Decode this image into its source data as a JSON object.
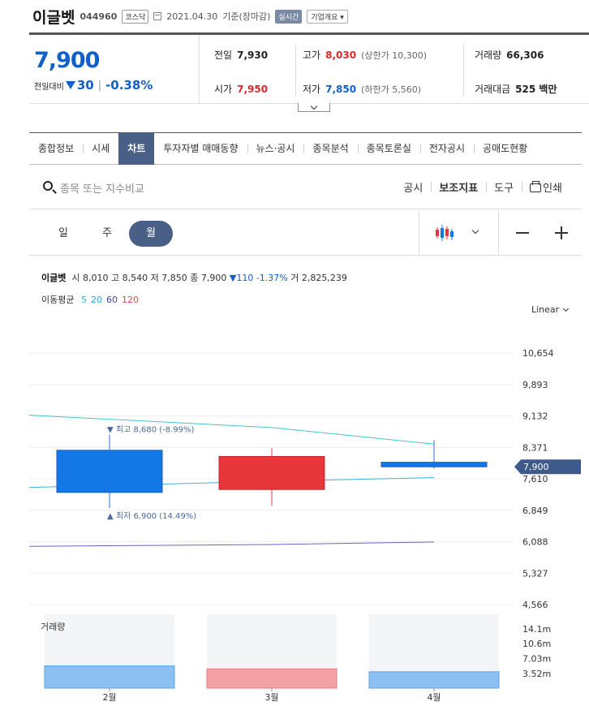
{
  "header": {
    "name": "이글벳",
    "code": "044960",
    "market": "코스닥",
    "date": "2021.04.30",
    "basis": "기준(장마감)",
    "live_badge": "실시간",
    "company_info": "기업개요"
  },
  "quote": {
    "price": "7,900",
    "change_label": "전일대비",
    "change": "30",
    "change_pct": "-0.38%",
    "prev_label": "전일",
    "prev": "7,930",
    "high_label": "고가",
    "high": "8,030",
    "upper_limit": "(상한가 10,300)",
    "volume_label": "거래량",
    "volume": "66,306",
    "open_label": "시가",
    "open": "7,950",
    "low_label": "저가",
    "low": "7,850",
    "lower_limit": "(하한가 5,560)",
    "amount_label": "거래대금",
    "amount": "525 백만"
  },
  "tabs": [
    "종합정보",
    "시세",
    "차트",
    "투자자별 매매동향",
    "뉴스·공시",
    "종목분석",
    "종목토론실",
    "전자공시",
    "공매도현황"
  ],
  "active_tab": 2,
  "search": {
    "placeholder": "종목 또는 지수비교",
    "disclosure": "공시",
    "indicators": "보조지표",
    "tools": "도구",
    "print": "인쇄"
  },
  "periods": [
    "일",
    "주",
    "월"
  ],
  "active_period": 2,
  "legend": {
    "name": "이글벳",
    "open_label": "시",
    "open": "8,010",
    "high_label": "고",
    "high": "8,540",
    "low_label": "저",
    "low": "7,850",
    "close_label": "종",
    "close": "7,900",
    "change": "▼110 -1.37%",
    "vol_label": "거",
    "volume": "2,825,239",
    "ma_label": "이동평균",
    "ma": [
      {
        "label": "5",
        "color": "#3ab0c0"
      },
      {
        "label": "20",
        "color": "#3a9ad8"
      },
      {
        "label": "60",
        "color": "#3c4aa0"
      },
      {
        "label": "120",
        "color": "#e05050"
      }
    ]
  },
  "scale_mode": "Linear",
  "volume_title": "거래량",
  "colors": {
    "up": "#e8373b",
    "down": "#1477e6",
    "accent": "#4a5f86",
    "price_tag": "#3d5a8a"
  },
  "chart_data": {
    "type": "candlestick",
    "categories": [
      "2월",
      "3월",
      "4월"
    ],
    "candles": [
      {
        "open": 8300,
        "high": 8680,
        "low": 6900,
        "close": 7280
      },
      {
        "open": 7350,
        "high": 8350,
        "low": 6960,
        "close": 8150
      },
      {
        "open": 8010,
        "high": 8540,
        "low": 7850,
        "close": 7900
      }
    ],
    "moving_averages": [
      {
        "name": "5",
        "values": [
          9050,
          8850,
          8450
        ]
      },
      {
        "name": "20",
        "values": [
          7450,
          7550,
          7640
        ]
      },
      {
        "name": "60",
        "values": [
          5990,
          6020,
          6080
        ]
      }
    ],
    "y_ticks": [
      10654,
      9893,
      9132,
      8371,
      7610,
      6849,
      6088,
      5327,
      4566
    ],
    "y_tick_labels": [
      "10,654",
      "9,893",
      "9,132",
      "8,371",
      "7,610",
      "6,849",
      "6,088",
      "5,327",
      "4,566"
    ],
    "ylim": [
      4566,
      10654
    ],
    "current_price": 7900,
    "current_price_label": "7,900",
    "max_annotation": "▼ 최고 8,680 (-8.99%)",
    "min_annotation": "▲ 최저 6,900 (14.49%)",
    "volume": {
      "values": [
        5.3,
        4.6,
        3.9
      ],
      "unit": "m",
      "ticks": [
        14.1,
        10.6,
        7.03,
        3.52
      ],
      "tick_labels": [
        "14.1m",
        "10.6m",
        "7.03m",
        "3.52m"
      ],
      "ymax": 17.6
    }
  }
}
